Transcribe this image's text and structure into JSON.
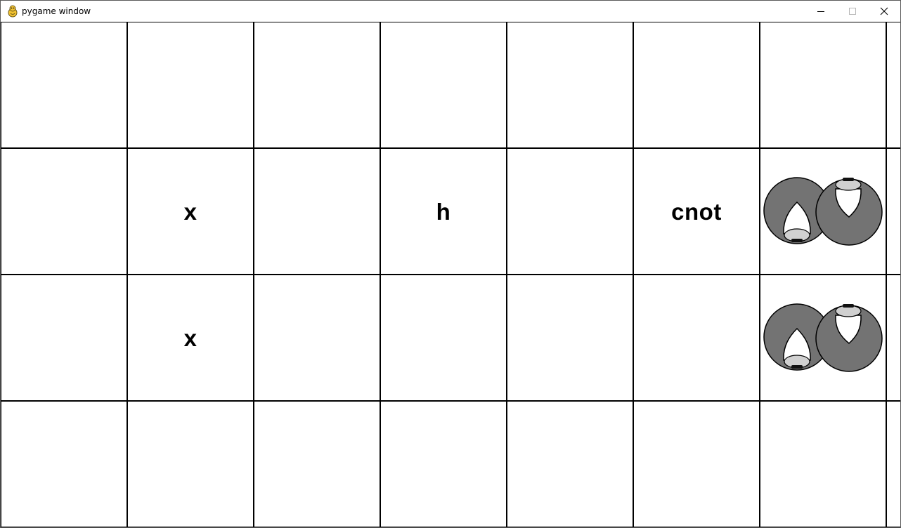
{
  "window": {
    "title": "pygame window",
    "app_icon": "pygame-snake-icon",
    "controls": [
      "minimize-icon",
      "maximize-icon",
      "close-icon"
    ]
  },
  "board": {
    "rows": [
      [
        "",
        "",
        "",
        "",
        "",
        "",
        "",
        ""
      ],
      [
        "",
        "x",
        "",
        "h",
        "",
        "cnot",
        "",
        ""
      ],
      [
        "",
        "x",
        "",
        "",
        "",
        "",
        "",
        ""
      ],
      [
        "",
        "",
        "",
        "",
        "",
        "",
        "",
        ""
      ]
    ],
    "pieces": [
      {
        "row": 1,
        "col": 6,
        "icon": "entangled-qubits-icon"
      },
      {
        "row": 2,
        "col": 6,
        "icon": "entangled-qubits-icon"
      }
    ],
    "colors": {
      "grid_line": "#000000",
      "piece_fill": "#737373",
      "piece_hole": "#ffffff",
      "piece_cap": "#d0d0d0"
    }
  }
}
